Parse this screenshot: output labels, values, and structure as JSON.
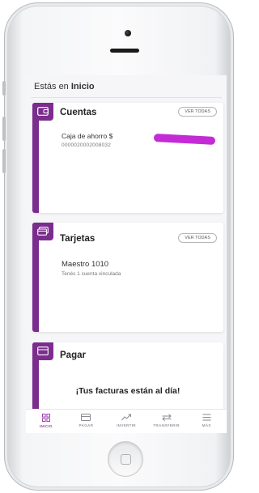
{
  "colors": {
    "brand": "#7b2d8e",
    "active_tab": "#a13fb3",
    "redaction": "#c42bd6"
  },
  "location": {
    "prefix": "Estás en",
    "current": "Inicio"
  },
  "cards": {
    "accounts": {
      "icon": "wallet-icon",
      "title": "Cuentas",
      "view_all": "VER TODAS",
      "account_name": "Caja de ahorro $",
      "account_number": "0000020002008032"
    },
    "cards": {
      "icon": "credit-card-icon",
      "title": "Tarjetas",
      "view_all": "VER TODAS",
      "card_name": "Maestro 1010",
      "linked_text": "Tenés 1 cuenta vinculada"
    },
    "pay": {
      "icon": "payment-card-icon",
      "title": "Pagar",
      "message": "¡Tus facturas están al día!"
    }
  },
  "tabbar": {
    "items": [
      {
        "label": "INICIO",
        "icon": "grid-icon",
        "active": true
      },
      {
        "label": "PAGAR",
        "icon": "payment-card-icon",
        "active": false
      },
      {
        "label": "INVERTIR",
        "icon": "trend-icon",
        "active": false
      },
      {
        "label": "TRANSFERIR",
        "icon": "transfer-icon",
        "active": false
      },
      {
        "label": "MÁS",
        "icon": "menu-list-icon",
        "active": false
      }
    ]
  }
}
